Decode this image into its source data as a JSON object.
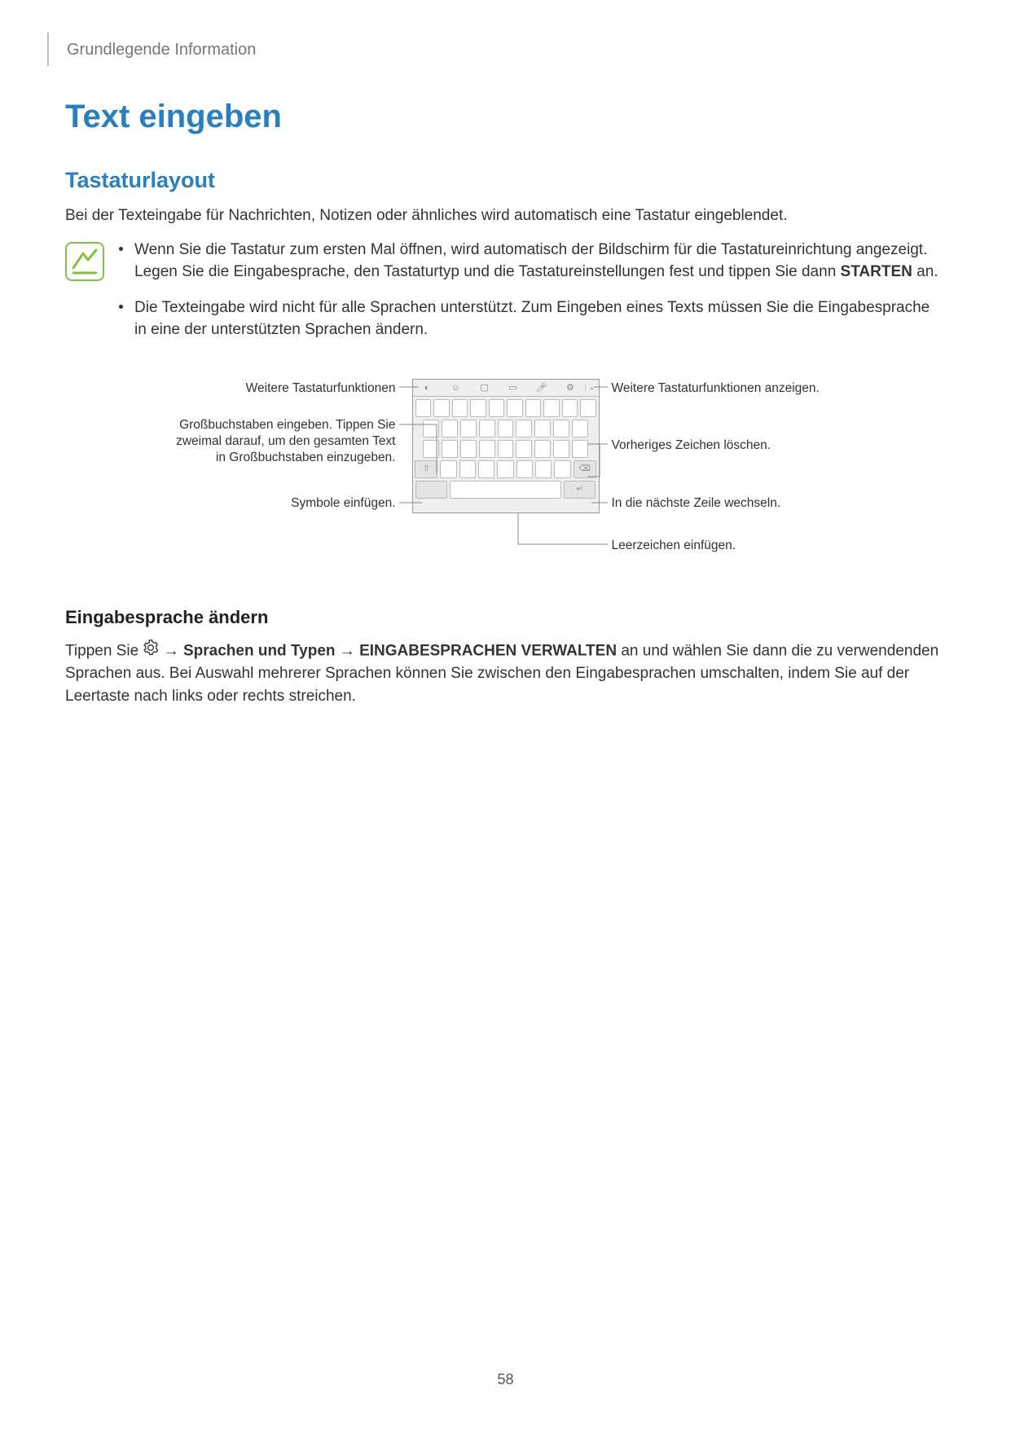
{
  "header": {
    "section": "Grundlegende Information"
  },
  "title": "Text eingeben",
  "h2": "Tastaturlayout",
  "intro": "Bei der Texteingabe für Nachrichten, Notizen oder ähnliches wird automatisch eine Tastatur eingeblendet.",
  "notes": [
    {
      "pre": "Wenn Sie die Tastatur zum ersten Mal öffnen, wird automatisch der Bildschirm für die Tastatureinrichtung angezeigt. Legen Sie die Eingabesprache, den Tastaturtyp und die Tastatureinstellungen fest und tippen Sie dann ",
      "bold": "STARTEN",
      "post": " an."
    },
    {
      "pre": "Die Texteingabe wird nicht für alle Sprachen unterstützt. Zum Eingeben eines Texts müssen Sie die Eingabesprache in eine der unterstützten Sprachen ändern.",
      "bold": "",
      "post": ""
    }
  ],
  "diagram": {
    "left": {
      "toolbar": "Weitere Tastaturfunktionen",
      "shift": "Großbuchstaben eingeben. Tippen Sie zweimal darauf, um den gesamten Text in Großbuchstaben einzugeben.",
      "symbols": "Symbole einfügen."
    },
    "right": {
      "more": "Weitere Tastaturfunktionen anzeigen.",
      "backspace": "Vorheriges Zeichen löschen.",
      "enter": "In die nächste Zeile wechseln.",
      "space": "Leerzeichen einfügen."
    }
  },
  "h3": "Eingabesprache ändern",
  "para2": {
    "p1": "Tippen Sie ",
    "arrow1": " → ",
    "b1": "Sprachen und Typen",
    "arrow2": " → ",
    "b2": "EINGABESPRACHEN VERWALTEN",
    "p2": " an und wählen Sie dann die zu verwendenden Sprachen aus. Bei Auswahl mehrerer Sprachen können Sie zwischen den Eingabesprachen umschalten, indem Sie auf der Leertaste nach links oder rechts streichen."
  },
  "pagenum": "58"
}
